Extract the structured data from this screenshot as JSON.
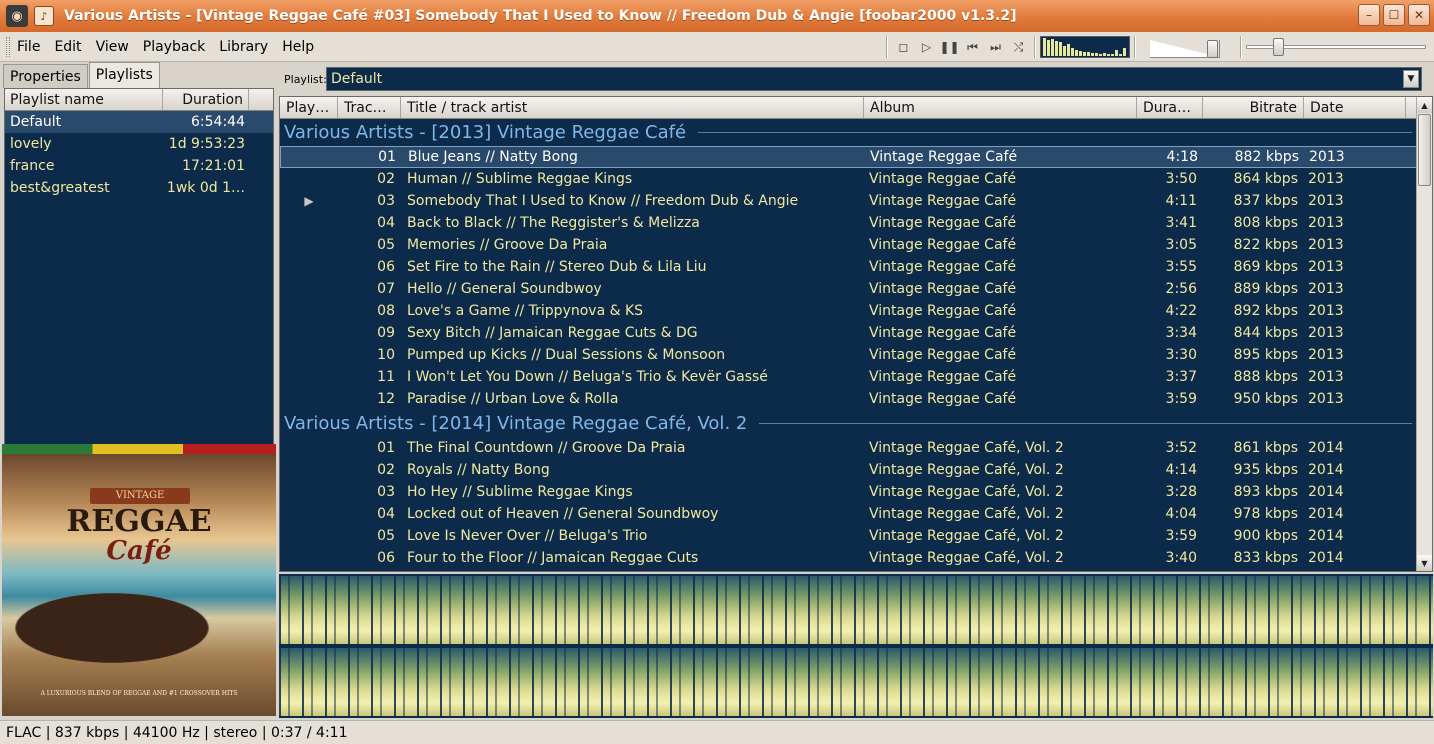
{
  "window": {
    "title": "Various Artists - [Vintage Reggae Café #03] Somebody That I Used to Know // Freedom Dub & Angie [foobar2000 v1.3.2]",
    "buttons": [
      "–",
      "☐",
      "✕"
    ]
  },
  "menu": [
    "File",
    "Edit",
    "View",
    "Playback",
    "Library",
    "Help"
  ],
  "toolbar": {
    "transport_icons": [
      "stop-icon",
      "play-icon",
      "pause-icon",
      "previous-icon",
      "next-icon",
      "random-icon"
    ],
    "seek_position": 0.15,
    "volume_level": 0.95
  },
  "left_panel": {
    "tabs": [
      "Properties",
      "Playlists"
    ],
    "active_tab": "Playlists",
    "columns": [
      "Playlist name",
      "Duration"
    ],
    "playlists": [
      {
        "name": "Default",
        "duration": "6:54:44",
        "selected": true
      },
      {
        "name": "lovely",
        "duration": "1d 9:53:23",
        "selected": false
      },
      {
        "name": "france",
        "duration": "17:21:01",
        "selected": false
      },
      {
        "name": "best&greatest",
        "duration": "1wk 0d 1…",
        "selected": false
      }
    ]
  },
  "album_art": {
    "badge": "VINTAGE",
    "title1": "REGGAE",
    "title2": "Café",
    "tagline": "A LUXURIOUS BLEND OF REGGAE AND #1 CROSSOVER HITS"
  },
  "playlist_bar": {
    "label": "Playlist:",
    "selected": "Default"
  },
  "columns": [
    "Play…",
    "Trac…",
    "Title / track artist",
    "Album",
    "Dura…",
    "Bitrate",
    "Date"
  ],
  "groups": [
    {
      "header": "Various Artists - [2013] Vintage Reggae Café",
      "tracks": [
        {
          "status": "",
          "no": "01",
          "title": "Blue Jeans // Natty Bong",
          "album": "Vintage Reggae Café",
          "duration": "4:18",
          "bitrate": "882 kbps",
          "date": "2013",
          "selected": true
        },
        {
          "status": "",
          "no": "02",
          "title": "Human // Sublime Reggae Kings",
          "album": "Vintage Reggae Café",
          "duration": "3:50",
          "bitrate": "864 kbps",
          "date": "2013"
        },
        {
          "status": "▶",
          "no": "03",
          "title": "Somebody That I Used to Know // Freedom Dub & Angie",
          "album": "Vintage Reggae Café",
          "duration": "4:11",
          "bitrate": "837 kbps",
          "date": "2013"
        },
        {
          "status": "",
          "no": "04",
          "title": "Back to Black // The Reggister's & Melizza",
          "album": "Vintage Reggae Café",
          "duration": "3:41",
          "bitrate": "808 kbps",
          "date": "2013"
        },
        {
          "status": "",
          "no": "05",
          "title": "Memories // Groove Da Praia",
          "album": "Vintage Reggae Café",
          "duration": "3:05",
          "bitrate": "822 kbps",
          "date": "2013"
        },
        {
          "status": "",
          "no": "06",
          "title": "Set Fire to the Rain // Stereo Dub & Lila Liu",
          "album": "Vintage Reggae Café",
          "duration": "3:55",
          "bitrate": "869 kbps",
          "date": "2013"
        },
        {
          "status": "",
          "no": "07",
          "title": "Hello // General Soundbwoy",
          "album": "Vintage Reggae Café",
          "duration": "2:56",
          "bitrate": "889 kbps",
          "date": "2013"
        },
        {
          "status": "",
          "no": "08",
          "title": "Love's a Game // Trippynova & KS",
          "album": "Vintage Reggae Café",
          "duration": "4:22",
          "bitrate": "892 kbps",
          "date": "2013"
        },
        {
          "status": "",
          "no": "09",
          "title": "Sexy Bitch // Jamaican Reggae Cuts & DG",
          "album": "Vintage Reggae Café",
          "duration": "3:34",
          "bitrate": "844 kbps",
          "date": "2013"
        },
        {
          "status": "",
          "no": "10",
          "title": "Pumped up Kicks // Dual Sessions & Monsoon",
          "album": "Vintage Reggae Café",
          "duration": "3:30",
          "bitrate": "895 kbps",
          "date": "2013"
        },
        {
          "status": "",
          "no": "11",
          "title": "I Won't Let You Down // Beluga's Trio & Kevër Gassé",
          "album": "Vintage Reggae Café",
          "duration": "3:37",
          "bitrate": "888 kbps",
          "date": "2013"
        },
        {
          "status": "",
          "no": "12",
          "title": "Paradise // Urban Love & Rolla",
          "album": "Vintage Reggae Café",
          "duration": "3:59",
          "bitrate": "950 kbps",
          "date": "2013"
        }
      ]
    },
    {
      "header": "Various Artists - [2014] Vintage Reggae Café, Vol. 2",
      "tracks": [
        {
          "status": "",
          "no": "01",
          "title": "The Final Countdown // Groove Da Praia",
          "album": "Vintage Reggae Café, Vol. 2",
          "duration": "3:52",
          "bitrate": "861 kbps",
          "date": "2014"
        },
        {
          "status": "",
          "no": "02",
          "title": "Royals // Natty Bong",
          "album": "Vintage Reggae Café, Vol. 2",
          "duration": "4:14",
          "bitrate": "935 kbps",
          "date": "2014"
        },
        {
          "status": "",
          "no": "03",
          "title": "Ho Hey // Sublime Reggae Kings",
          "album": "Vintage Reggae Café, Vol. 2",
          "duration": "3:28",
          "bitrate": "893 kbps",
          "date": "2014"
        },
        {
          "status": "",
          "no": "04",
          "title": "Locked out of Heaven // General Soundbwoy",
          "album": "Vintage Reggae Café, Vol. 2",
          "duration": "4:04",
          "bitrate": "978 kbps",
          "date": "2014"
        },
        {
          "status": "",
          "no": "05",
          "title": "Love Is Never Over // Beluga's Trio",
          "album": "Vintage Reggae Café, Vol. 2",
          "duration": "3:59",
          "bitrate": "900 kbps",
          "date": "2014"
        },
        {
          "status": "",
          "no": "06",
          "title": "Four to the Floor // Jamaican Reggae Cuts",
          "album": "Vintage Reggae Café, Vol. 2",
          "duration": "3:40",
          "bitrate": "833 kbps",
          "date": "2014"
        }
      ]
    }
  ],
  "status_bar": "FLAC | 837 kbps | 44100 Hz | stereo | 0:37 / 4:11",
  "colors": {
    "list_bg": "#0c2a4a",
    "list_text": "#f0e8a0",
    "group_text": "#7fb8e8",
    "title_bar": "#e07a3a"
  }
}
